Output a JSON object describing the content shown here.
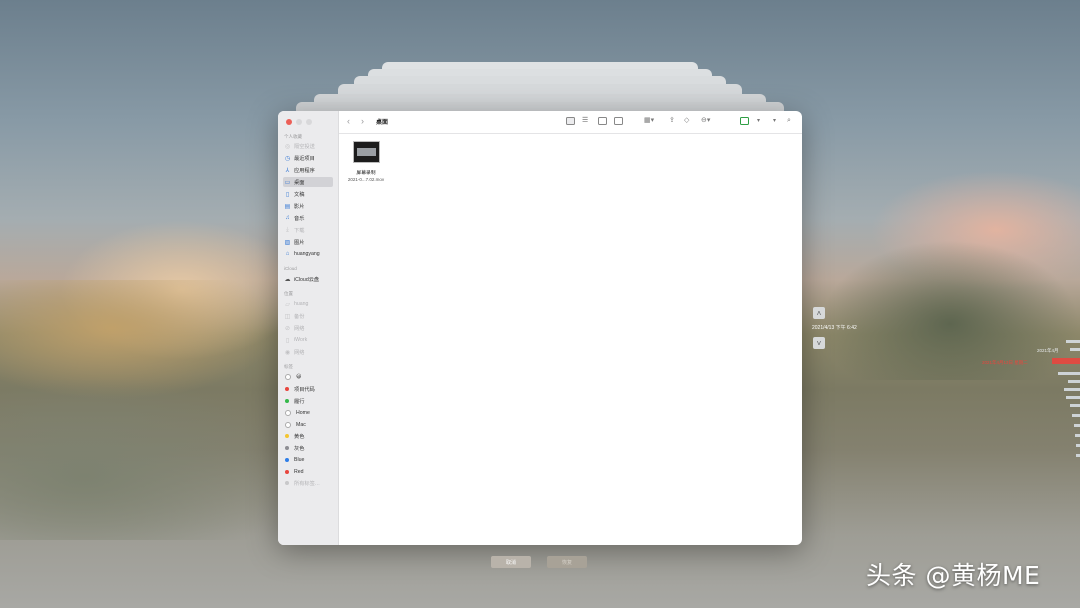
{
  "colors": {
    "accent": "#3a7bd5",
    "timeline_current": "#e8463e",
    "traffic_close": "#ec5f57",
    "traffic_min": "#d8d8da",
    "traffic_max": "#d8d8da"
  },
  "toolbar": {
    "back_icon": "chevron-left-icon",
    "forward_icon": "chevron-right-icon",
    "folder_title": "桌面"
  },
  "sidebar": {
    "sections": [
      {
        "title": "个人收藏"
      },
      {
        "title": "iCloud"
      },
      {
        "title": "位置"
      },
      {
        "title": "标签"
      }
    ],
    "favorites": [
      {
        "label": "隔空投送",
        "icon": "airdrop-icon",
        "dim": true
      },
      {
        "label": "最近项目",
        "icon": "clock-icon",
        "dim": false
      },
      {
        "label": "应用程序",
        "icon": "applications-icon",
        "dim": false
      },
      {
        "label": "桌面",
        "icon": "desktop-icon",
        "dim": false,
        "selected": true
      },
      {
        "label": "文稿",
        "icon": "document-icon",
        "dim": false
      },
      {
        "label": "影片",
        "icon": "film-icon",
        "dim": false
      },
      {
        "label": "音乐",
        "icon": "music-icon",
        "dim": false
      },
      {
        "label": "下载",
        "icon": "download-icon",
        "dim": true
      },
      {
        "label": "图片",
        "icon": "picture-icon",
        "dim": false
      },
      {
        "label": "huangyang",
        "icon": "home-icon",
        "dim": false
      }
    ],
    "icloud": [
      {
        "label": "iCloud云盘",
        "icon": "cloud-icon",
        "dim": false
      }
    ],
    "locations": [
      {
        "label": "huang",
        "icon": "laptop-icon",
        "dim": true
      },
      {
        "label": "备份",
        "icon": "disk-icon",
        "dim": true
      },
      {
        "label": "网络",
        "icon": "globe-icon",
        "dim": true
      },
      {
        "label": "iWork",
        "icon": "drive-icon",
        "dim": true
      },
      {
        "label": "网络",
        "icon": "network-icon",
        "dim": true
      }
    ],
    "tags": [
      {
        "label": "😃",
        "color": "#ffffff",
        "dim": false
      },
      {
        "label": "项目代码",
        "color": "#e8463e"
      },
      {
        "label": "履行",
        "color": "#34b84a"
      },
      {
        "label": "Home",
        "color": "#ffffff"
      },
      {
        "label": "Mac",
        "color": "#ffffff"
      },
      {
        "label": "黄色",
        "color": "#f4c531"
      },
      {
        "label": "灰色",
        "color": "#8e8e93"
      },
      {
        "label": "Blue",
        "color": "#2f7ee8"
      },
      {
        "label": "Red",
        "color": "#e8463e"
      },
      {
        "label": "所有标签…",
        "color": "#c8c8ca",
        "dim": true
      }
    ]
  },
  "file": {
    "name": "屏幕录制",
    "subtitle": "2021-0...7.02.mov"
  },
  "buttons": {
    "cancel": "取消",
    "restore": "恢复"
  },
  "time_machine": {
    "current_date": "2021/4/13 下午 6:42",
    "timeline_top_label": "2021年4月",
    "timeline_current_label": "2021年4月13日 星期二"
  },
  "watermark": "头条 @黄杨ME"
}
